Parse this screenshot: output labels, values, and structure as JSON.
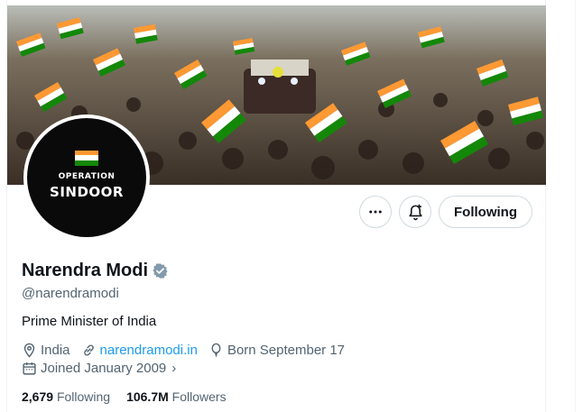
{
  "profile": {
    "name": "Narendra Modi",
    "handle": "@narendramodi",
    "bio": "Prime Minister of India",
    "location": "India",
    "website": "narendramodi.in",
    "birthday": "Born September 17",
    "joined": "Joined January 2009",
    "joined_chevron": "›"
  },
  "avatar": {
    "line1": "OPERATION",
    "line2": "SINDOOR"
  },
  "actions": {
    "more_icon": "more-horizontal-icon",
    "notify_icon": "bell-plus-icon",
    "following_label": "Following"
  },
  "stats": {
    "following_count": "2,679",
    "following_label": "Following",
    "followers_count": "106.7M",
    "followers_label": "Followers"
  },
  "colors": {
    "link": "#1d9bf0",
    "verified_badge": "#829aab",
    "muted_text": "#536471",
    "saffron": "#ff9933",
    "india_green": "#138808"
  }
}
